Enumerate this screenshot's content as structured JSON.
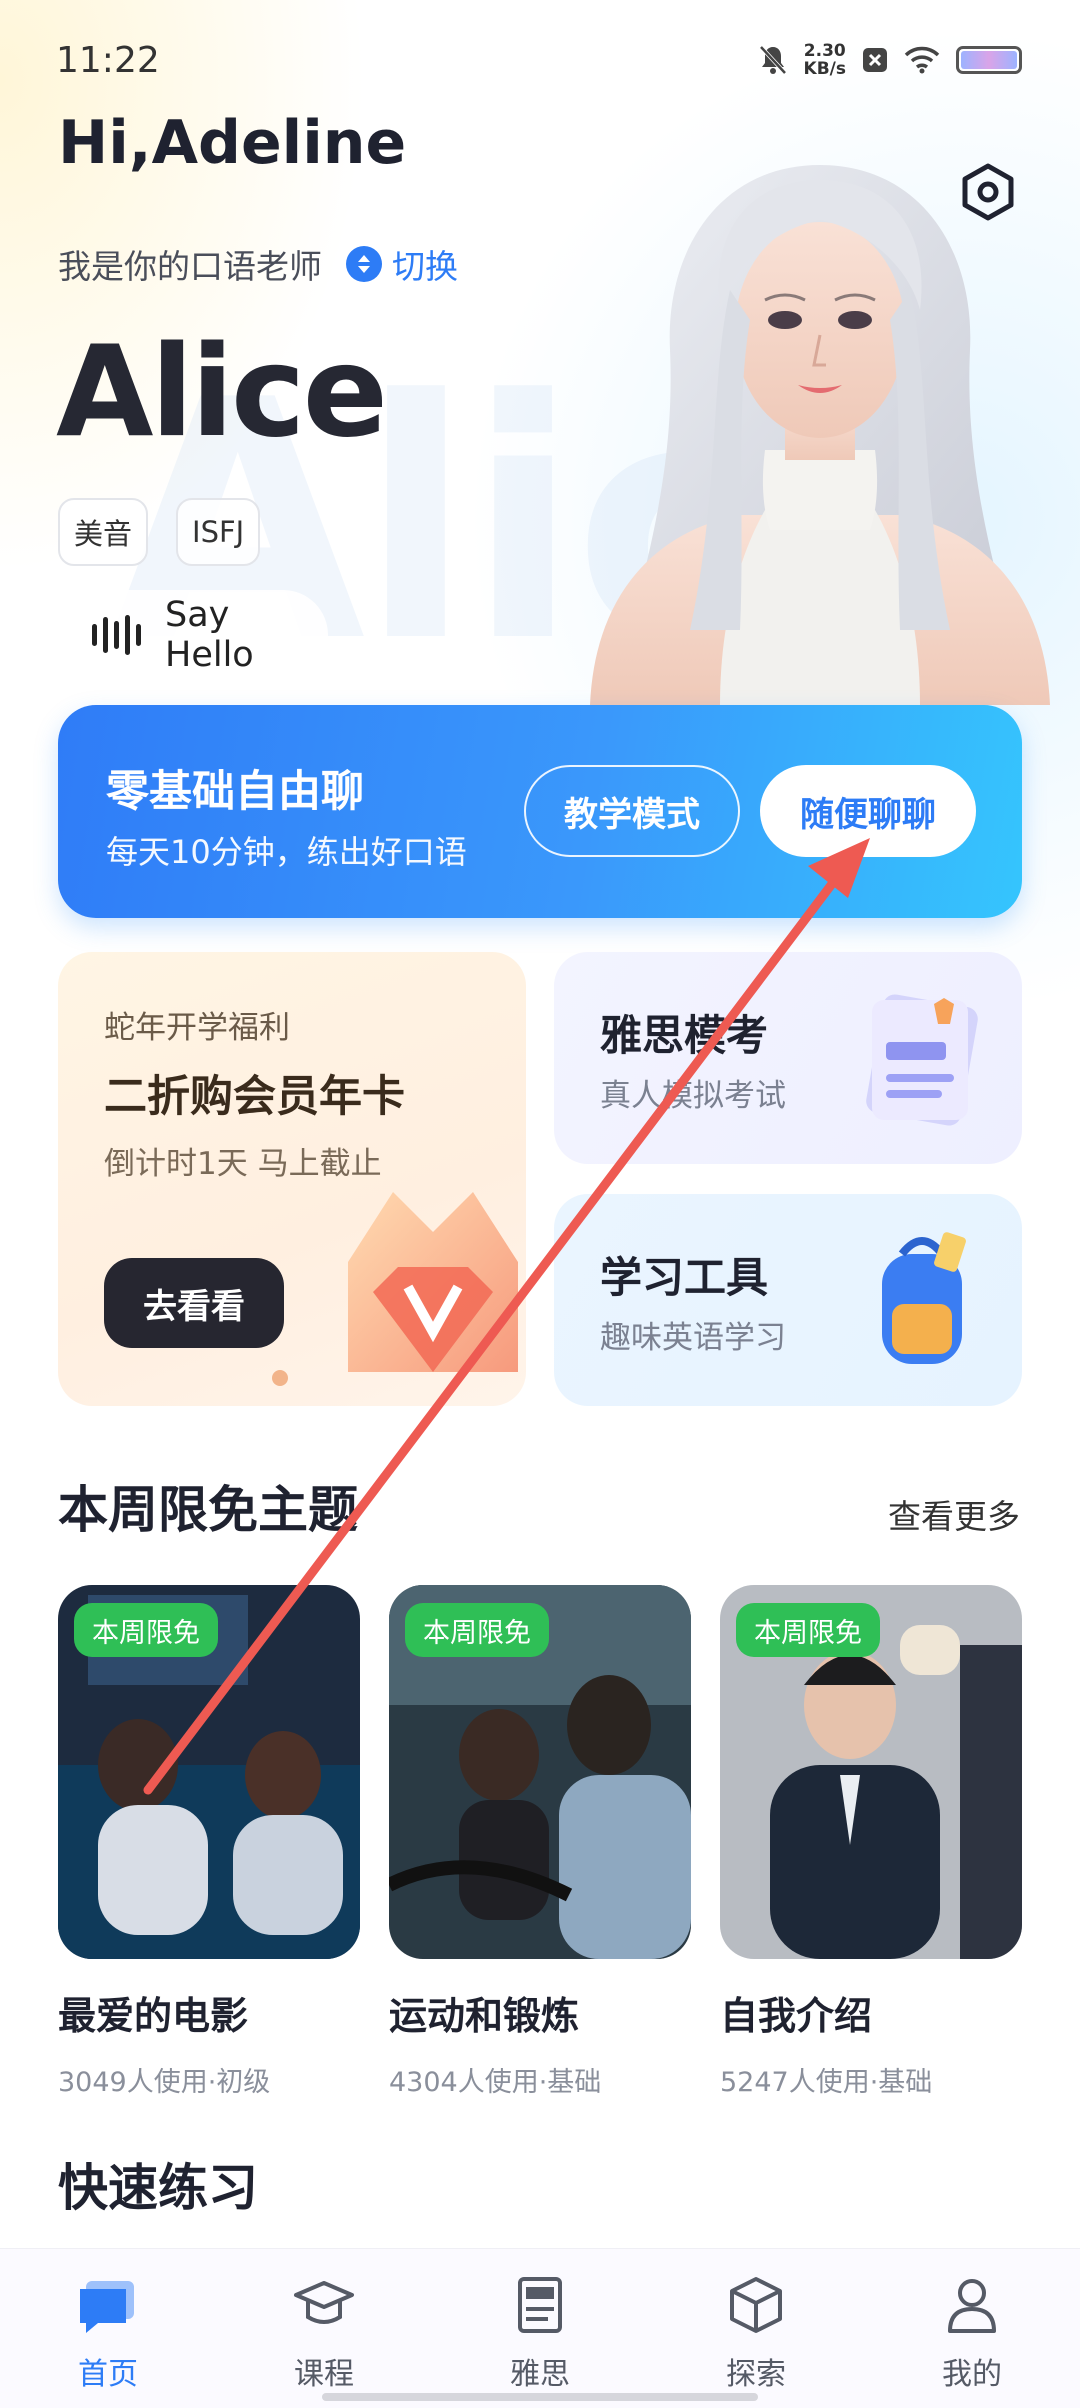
{
  "status_bar": {
    "time": "11:22",
    "net_speed_value": "2.30",
    "net_speed_unit": "KB/s"
  },
  "header": {
    "greeting": "Hi,Adeline",
    "teacher_intro": "我是你的口语老师",
    "switch_label": "切换",
    "teacher_name": "Alice",
    "tags": [
      "美音",
      "ISFJ"
    ],
    "say_hello": "Say Hello"
  },
  "chat_banner": {
    "title": "零基础自由聊",
    "subtitle": "每天10分钟，练出好口语",
    "teach_mode": "教学模式",
    "casual_chat": "随便聊聊"
  },
  "promo": {
    "kicker": "蛇年开学福利",
    "title": "二折购会员年卡",
    "countdown": "倒计时1天 马上截止",
    "button": "去看看"
  },
  "cards": {
    "ielts": {
      "title": "雅思模考",
      "subtitle": "真人模拟考试"
    },
    "tools": {
      "title": "学习工具",
      "subtitle": "趣味英语学习"
    }
  },
  "weekly": {
    "title": "本周限免主题",
    "see_more": "查看更多",
    "topics": [
      {
        "badge": "本周限免",
        "name": "最爱的电影",
        "meta": "3049人使用·初级"
      },
      {
        "badge": "本周限免",
        "name": "运动和锻炼",
        "meta": "4304人使用·基础"
      },
      {
        "badge": "本周限免",
        "name": "自我介绍",
        "meta": "5247人使用·基础"
      }
    ]
  },
  "quick_practice": {
    "title": "快速练习"
  },
  "bottom_nav": {
    "items": [
      {
        "label": "首页",
        "icon": "chat-bubble-icon",
        "active": true
      },
      {
        "label": "课程",
        "icon": "graduation-cap-icon",
        "active": false
      },
      {
        "label": "雅思",
        "icon": "ielts-book-icon",
        "active": false
      },
      {
        "label": "探索",
        "icon": "cube-icon",
        "active": false
      },
      {
        "label": "我的",
        "icon": "person-icon",
        "active": false
      }
    ]
  },
  "colors": {
    "accent": "#2d7cf6",
    "badge_green": "#2fbf56",
    "arrow_red": "#ee5a52"
  }
}
